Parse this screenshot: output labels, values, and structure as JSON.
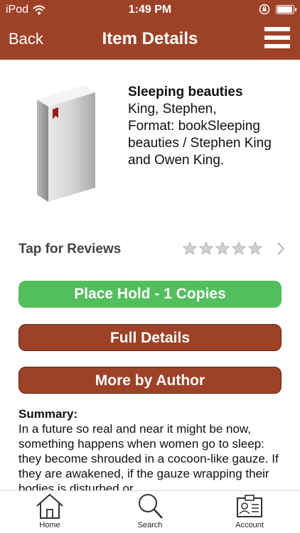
{
  "status_bar": {
    "carrier": "iPod",
    "time": "1:49 PM",
    "battery_level": 1.0,
    "icons": [
      "wifi-icon",
      "orientation-lock-icon",
      "battery-icon"
    ]
  },
  "nav": {
    "back_label": "Back",
    "title": "Item Details",
    "menu_icon": "hamburger-menu-icon"
  },
  "item": {
    "cover_icon": "book-icon",
    "title": "Sleeping beauties",
    "author": "King, Stephen,",
    "format_line": "Format: bookSleeping beauties / Stephen King and Owen King."
  },
  "reviews": {
    "label": "Tap for Reviews",
    "rating": 0,
    "max_rating": 5
  },
  "buttons": {
    "place_hold": "Place Hold - 1 Copies",
    "full_details": "Full Details",
    "more_by_author": "More by Author"
  },
  "summary": {
    "heading": "Summary:",
    "text": "In a future so real and near it might be now, something happens when women go to sleep:  they become shrouded in a cocoon-like gauze. If they are awakened, if the gauze wrapping their bodies is disturbed or"
  },
  "tabs": [
    {
      "label": "Home",
      "icon": "home-icon"
    },
    {
      "label": "Search",
      "icon": "search-icon"
    },
    {
      "label": "Account",
      "icon": "account-card-icon"
    }
  ],
  "colors": {
    "brand": "#9e4227",
    "hold_green": "#51bf5c",
    "star_gray": "#d0d0d0"
  }
}
